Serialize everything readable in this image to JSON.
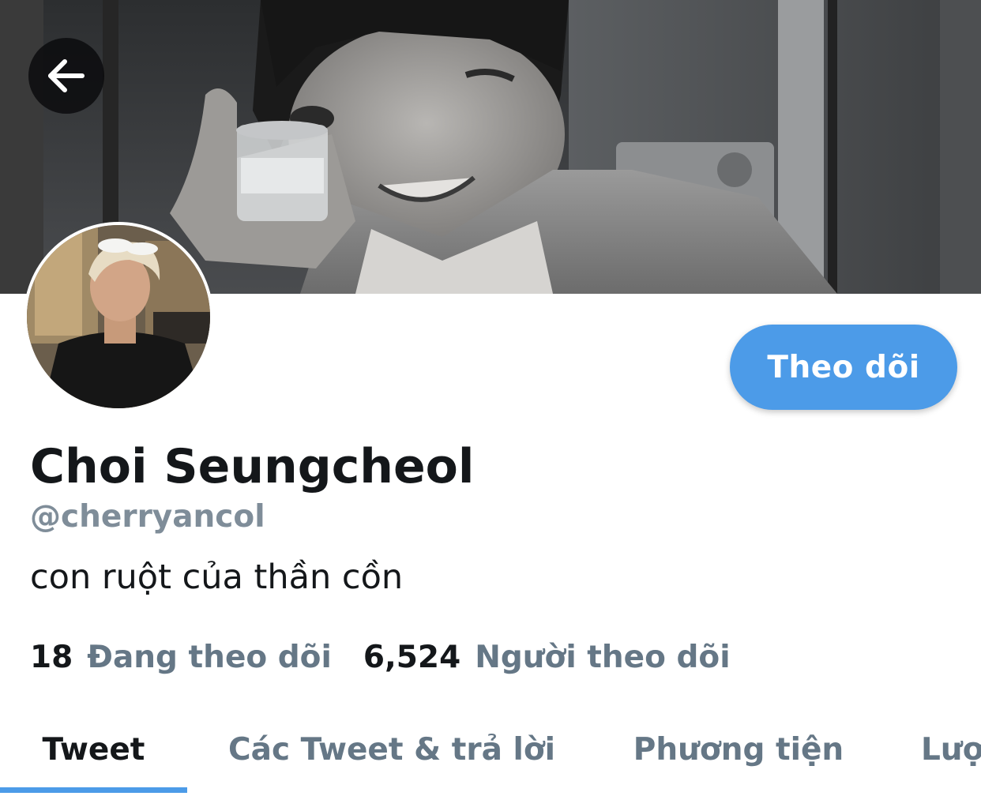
{
  "header": {
    "back_icon": "arrow-left-icon",
    "banner_image": "profile-banner-photo"
  },
  "profile": {
    "avatar_image": "profile-avatar-photo",
    "display_name": "Choi Seungcheol",
    "handle": "@cherryancol",
    "bio": "con ruột của thần cồn",
    "follow_label": "Theo dõi",
    "following_count": "18",
    "following_label": "Đang theo dõi",
    "followers_count": "6,524",
    "followers_label": "Người theo dõi"
  },
  "tabs": [
    {
      "label": "Tweet",
      "active": true
    },
    {
      "label": "Các Tweet & trả lời",
      "active": false
    },
    {
      "label": "Phương tiện",
      "active": false
    },
    {
      "label": "Lượt thích",
      "active": false
    }
  ],
  "colors": {
    "accent": "#4c9be8",
    "text_primary": "#14171a",
    "text_secondary": "#657786"
  }
}
